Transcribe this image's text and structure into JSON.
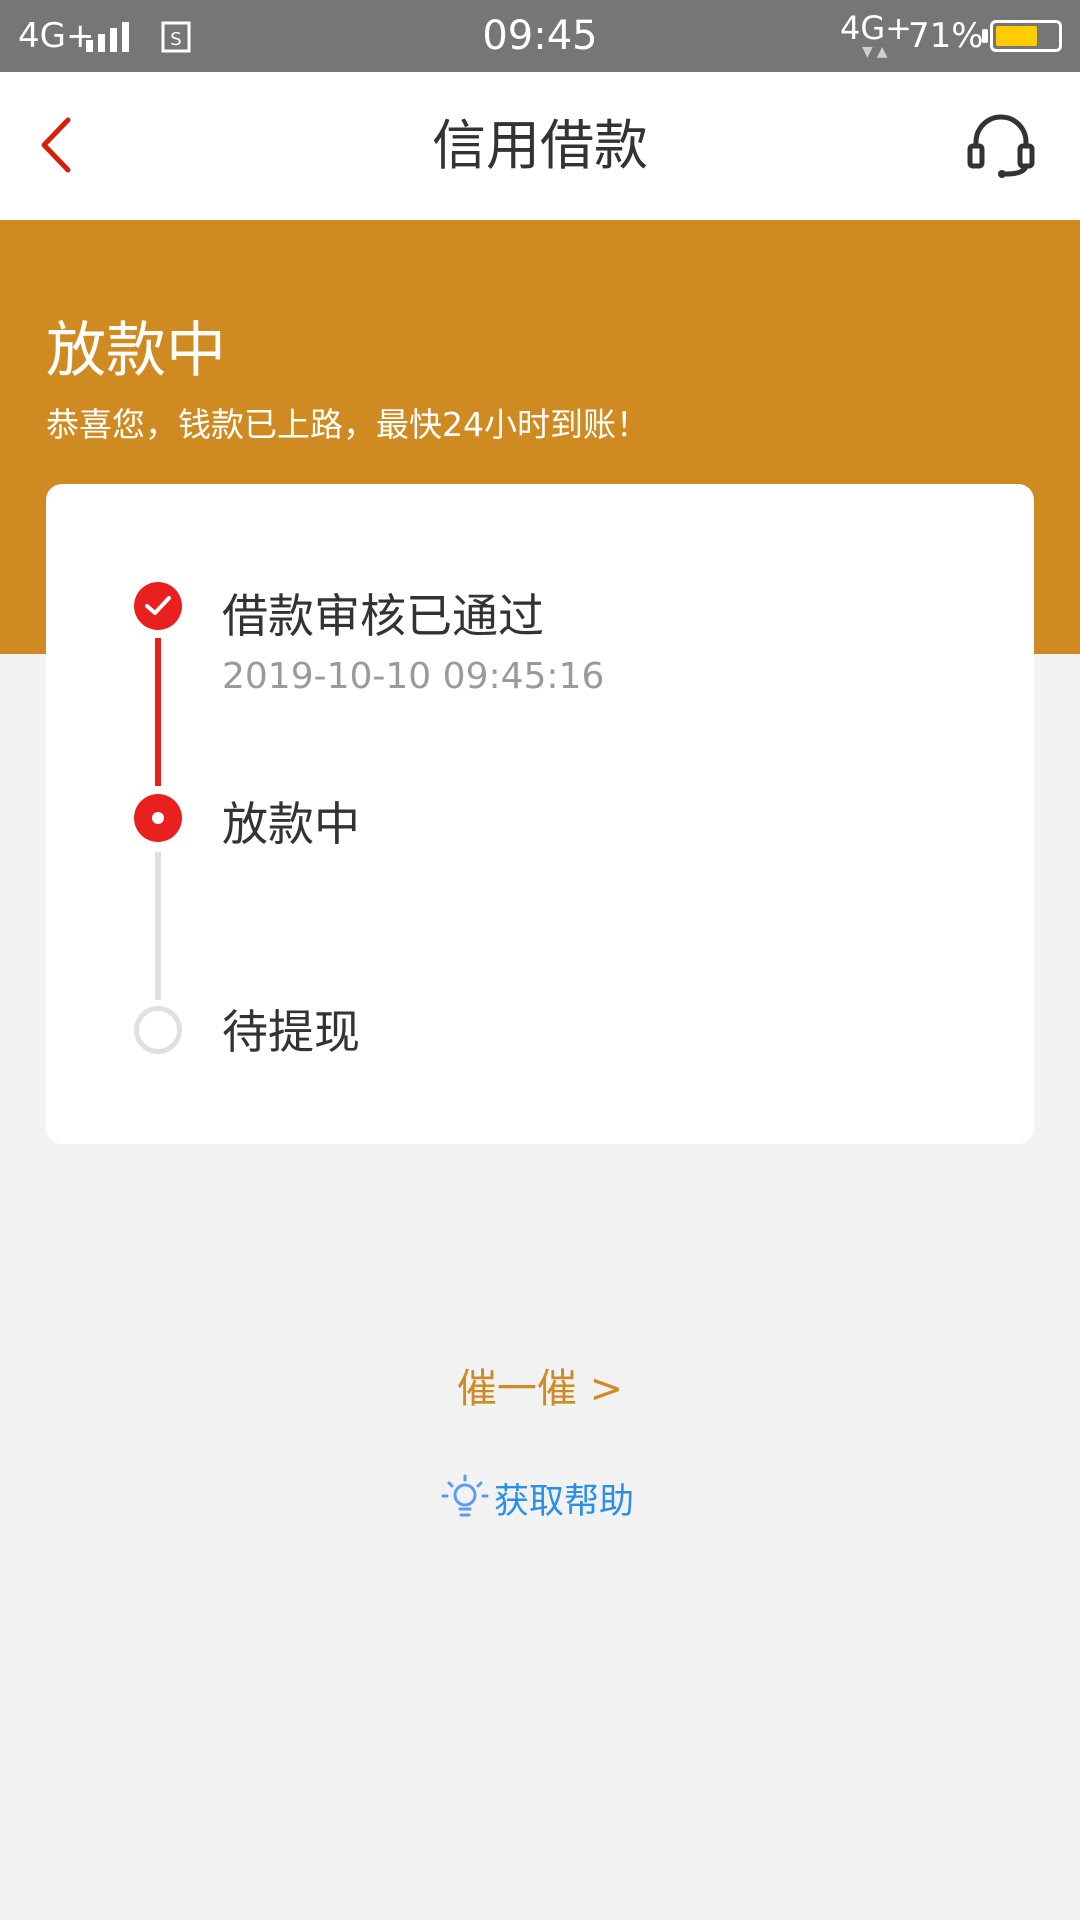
{
  "status_bar": {
    "network_left": "4G+",
    "time": "09:45",
    "network_right": "4G+",
    "battery_percent": "71%",
    "battery_level": 0.71,
    "battery_color": "#ffcc00"
  },
  "nav": {
    "title": "信用借款",
    "back_icon": "chevron-left-icon",
    "service_icon": "headset-icon",
    "back_color": "#d81e06"
  },
  "banner": {
    "title": "放款中",
    "subtitle": "恭喜您，钱款已上路，最快24小时到账！",
    "color": "#d08a22"
  },
  "steps": [
    {
      "label": "借款审核已通过",
      "time": "2019-10-10 09:45:16",
      "state": "done"
    },
    {
      "label": "放款中",
      "state": "active"
    },
    {
      "label": "待提现",
      "state": "pending"
    }
  ],
  "actions": {
    "urge_label": "催一催 >",
    "help_label": "获取帮助",
    "help_icon": "lightbulb-icon"
  },
  "colors": {
    "accent_red": "#e8201e",
    "accent_orange": "#d08a22",
    "link_blue": "#2a8fe8"
  }
}
